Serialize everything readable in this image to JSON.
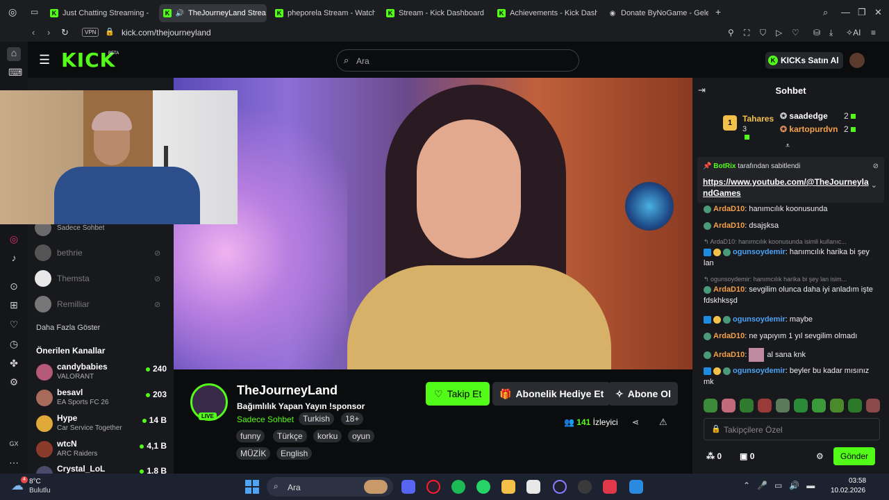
{
  "browser": {
    "tabs": [
      {
        "title": "Just Chatting Streaming -",
        "icon": "kick"
      },
      {
        "title": "TheJourneyLand Strea",
        "icon": "kick",
        "active": true
      },
      {
        "title": "pheporela Stream - Watch",
        "icon": "kick"
      },
      {
        "title": "Stream - Kick Dashboard",
        "icon": "kick"
      },
      {
        "title": "Achievements - Kick Dash",
        "icon": "kick"
      },
      {
        "title": "Donate ByNoGame - Geler",
        "icon": "bynogame"
      }
    ],
    "vpn_label": "VPN",
    "url": "kick.com/thejourneyland",
    "ai_label": "AI"
  },
  "header": {
    "logo": "KICK",
    "beta": "BETA",
    "search_placeholder": "Ara",
    "kicks_button": "KICKs Satın Al"
  },
  "sidebar": {
    "followed": [
      {
        "name": "Sadece Sohbet",
        "offline": false
      },
      {
        "name": "bethrie",
        "offline": true
      },
      {
        "name": "Themsta",
        "offline": true
      },
      {
        "name": "Remilliar",
        "offline": true
      }
    ],
    "show_more": "Daha Fazla Göster",
    "recommended_title": "Önerilen Kanallar",
    "recommended": [
      {
        "name": "candybabies",
        "category": "VALORANT",
        "viewers": "240",
        "color": "#b65a7a"
      },
      {
        "name": "besavl",
        "category": "EA Sports FC 26",
        "viewers": "203",
        "color": "#a86a5a"
      },
      {
        "name": "Hype",
        "category": "Car Service Together",
        "viewers": "14 B",
        "color": "#e0a93a"
      },
      {
        "name": "wtcN",
        "category": "ARC Raiders",
        "viewers": "4,1 B",
        "color": "#8a3a2a"
      },
      {
        "name": "Crystal_LoL",
        "category": "",
        "viewers": "1,8 B",
        "color": "#4a4a6a"
      }
    ]
  },
  "channel": {
    "name": "TheJourneyLand",
    "live": "LIVE",
    "title": "Bağımlılık Yapan Yayın !sponsor",
    "category": "Sadece Sohbet",
    "tags_row1": [
      "Turkish",
      "18+"
    ],
    "tags_row2": [
      "funny",
      "Türkçe",
      "korku",
      "oyun"
    ],
    "tags_row3": [
      "MÜZİK",
      "English"
    ],
    "follow_label": "Takip Et",
    "gift_label": "Abonelik Hediye Et",
    "subscribe_label": "Abone Ol",
    "viewer_count": "141",
    "viewer_label": "İzleyici"
  },
  "chat": {
    "title": "Sohbet",
    "leaderboard": {
      "first": {
        "rank": "1",
        "name": "Tahares",
        "value": "3"
      },
      "second": {
        "name": "saadedge",
        "value": "2"
      },
      "third": {
        "name": "kartopurdvn",
        "value": "2"
      }
    },
    "pinned": {
      "pinned_by_user": "BotRix",
      "pinned_by_suffix": "tarafından sabitlendi",
      "link": "https://www.youtube.com/@TheJourneylandGames"
    },
    "messages": [
      {
        "type": "msg",
        "user": "ArdaD10",
        "color": "#f5a04a",
        "text": "hanımcılık koonusunda"
      },
      {
        "type": "msg",
        "user": "ArdaD10",
        "color": "#f5a04a",
        "text": "dsajşksa"
      },
      {
        "type": "reply",
        "text": "ArdaD10: hanımcılık koonusunda isimli kullanıc..."
      },
      {
        "type": "msg",
        "user": "ogunsoydemir",
        "color": "#4aa3f5",
        "text": "hanımcılık harika bi şey lan"
      },
      {
        "type": "reply",
        "text": "ogunsoydemir: hanımcılık harika bi şey lan isim..."
      },
      {
        "type": "msg",
        "user": "ArdaD10",
        "color": "#f5a04a",
        "text": "sevgilim olunca daha iyi anladım işte fdskhksşd"
      },
      {
        "type": "msg",
        "user": "ogunsoydemir",
        "color": "#4aa3f5",
        "text": "maybe"
      },
      {
        "type": "msg",
        "user": "ArdaD10",
        "color": "#f5a04a",
        "text": "ne yapıyım 1 yıl sevgilim olmadı"
      },
      {
        "type": "msg",
        "user": "ArdaD10",
        "color": "#f5a04a",
        "text": "al sana knk"
      },
      {
        "type": "msg",
        "user": "ogunsoydemir",
        "color": "#4aa3f5",
        "text": "beyler bu kadar mısınız mk"
      }
    ],
    "input_placeholder": "Takipçilere Özel",
    "points_a": "0",
    "points_b": "0",
    "send_label": "Gönder"
  },
  "taskbar": {
    "weather_badge": "4",
    "temperature": "8°C",
    "weather": "Bulutlu",
    "search_placeholder": "Ara",
    "time": "03:58",
    "date": "10.02.2026"
  }
}
